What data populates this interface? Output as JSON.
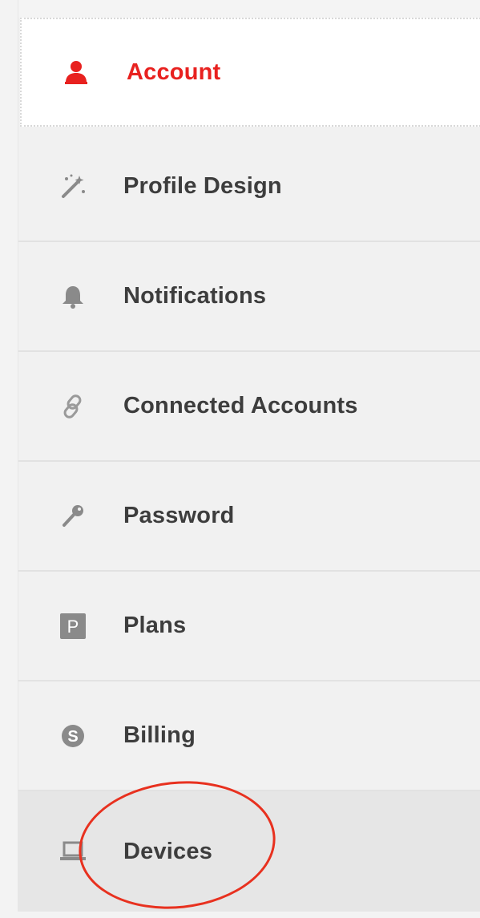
{
  "sidebar": {
    "items": [
      {
        "label": "Account",
        "icon": "user-icon",
        "state": "active"
      },
      {
        "label": "Profile Design",
        "icon": "magic-wand-icon",
        "state": "normal"
      },
      {
        "label": "Notifications",
        "icon": "bell-icon",
        "state": "normal"
      },
      {
        "label": "Connected Accounts",
        "icon": "link-icon",
        "state": "normal"
      },
      {
        "label": "Password",
        "icon": "key-icon",
        "state": "normal"
      },
      {
        "label": "Plans",
        "icon": "plans-icon",
        "icon_text": "P",
        "state": "normal"
      },
      {
        "label": "Billing",
        "icon": "billing-icon",
        "icon_text": "S",
        "state": "normal"
      },
      {
        "label": "Devices",
        "icon": "laptop-icon",
        "state": "highlighted"
      }
    ]
  },
  "colors": {
    "accent": "#e8211f",
    "text": "#3d3d3d",
    "icon": "#8a8a8a",
    "annotation": "#e8311f"
  }
}
